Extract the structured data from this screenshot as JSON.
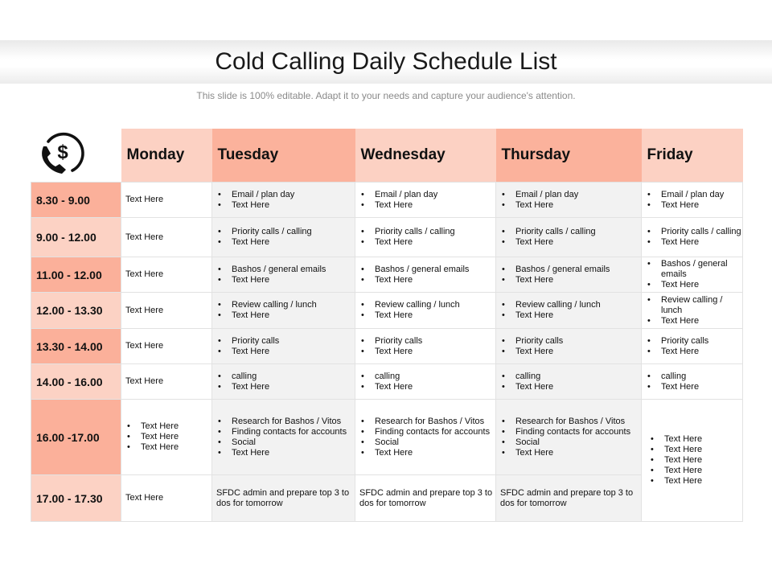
{
  "title": "Cold Calling Daily Schedule List",
  "subtitle": "This slide is 100% editable. Adapt it to your needs and capture your audience's attention.",
  "icon": "phone-dollar-icon",
  "days": [
    "Monday",
    "Tuesday",
    "Wednesday",
    "Thursday",
    "Friday"
  ],
  "times": [
    "8.30 - 9.00",
    "9.00 - 12.00",
    "11.00 - 12.00",
    "12.00 - 13.30",
    "13.30 - 14.00",
    "14.00 - 16.00",
    "16.00 -17.00",
    "17.00 - 17.30"
  ],
  "monday": {
    "r0": "Text Here",
    "r1": "Text Here",
    "r2": "Text Here",
    "r3": "Text Here",
    "r4": "Text Here",
    "r5": "Text Here",
    "r6": [
      "Text Here",
      "Text Here",
      "Text Here"
    ],
    "r7": "Text Here"
  },
  "rows": [
    [
      "Email  / plan day",
      "Text Here"
    ],
    [
      "Priority calls / calling",
      "Text Here"
    ],
    [
      "Bashos / general emails",
      "Text Here"
    ],
    [
      "Review calling / lunch",
      "Text Here"
    ],
    [
      "Priority calls",
      "Text Here"
    ],
    [
      "calling",
      "Text Here"
    ],
    [
      "Research for Bashos / Vitos",
      "Finding contacts for accounts",
      "Social",
      "Text Here"
    ]
  ],
  "last_row_note": "SFDC  admin and prepare top 3 to dos for tomorrow",
  "friday_last": [
    "Text Here",
    "Text Here",
    "Text Here",
    "Text Here",
    "Text Here"
  ]
}
